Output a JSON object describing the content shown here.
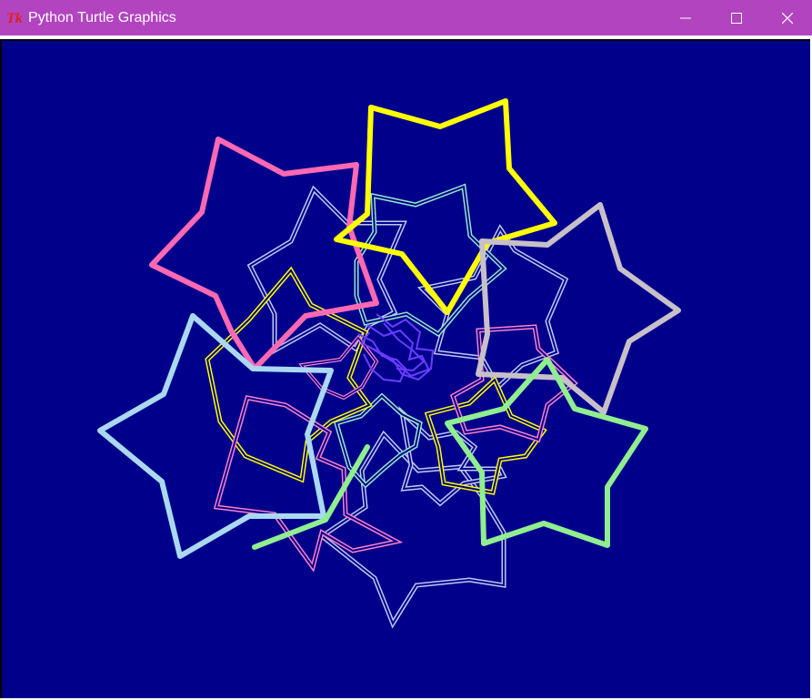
{
  "window": {
    "title": "Python Turtle Graphics",
    "icon": "tk-feather-icon",
    "controls": [
      "minimize-icon",
      "maximize-icon",
      "close-icon"
    ]
  },
  "colors": {
    "titlebar": "#b244c0",
    "canvas_background": "#00008b",
    "star_pink": "#ff69b4",
    "star_yellow": "#ffff00",
    "star_silver": "#c8c0c8",
    "star_lightblue": "#aad8f0",
    "star_green": "#90ee90",
    "outline_lavender": "#c0c8f0",
    "outline_mint": "#98e8c8",
    "outline_yellow": "#ffff00",
    "outline_pink": "#ff80c8",
    "center_purple": "#6a3cff"
  }
}
